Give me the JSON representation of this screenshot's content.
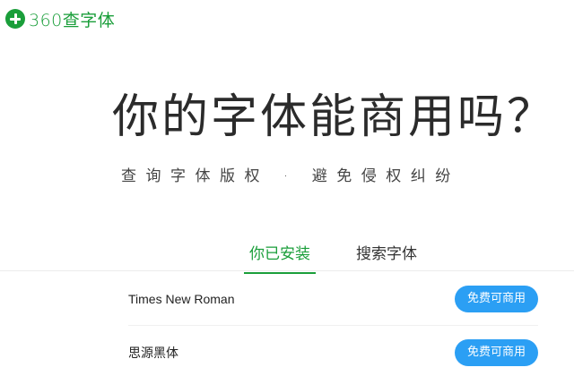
{
  "logo": {
    "text": "360查字体",
    "icon": "plus-cross-icon",
    "color": "#1a9e3a"
  },
  "hero": {
    "title": "你的字体能商用吗？",
    "subtitle": "查询字体版权 · 避免侵权纠纷"
  },
  "tabs": [
    {
      "label": "你已安装",
      "active": true
    },
    {
      "label": "搜索字体",
      "active": false
    }
  ],
  "fonts": [
    {
      "name": "Times New Roman",
      "badge": "免费可商用"
    },
    {
      "name": "思源黑体",
      "badge": "免费可商用"
    }
  ],
  "colors": {
    "accent": "#1a9e3a",
    "badge": "#2b9ff4"
  }
}
